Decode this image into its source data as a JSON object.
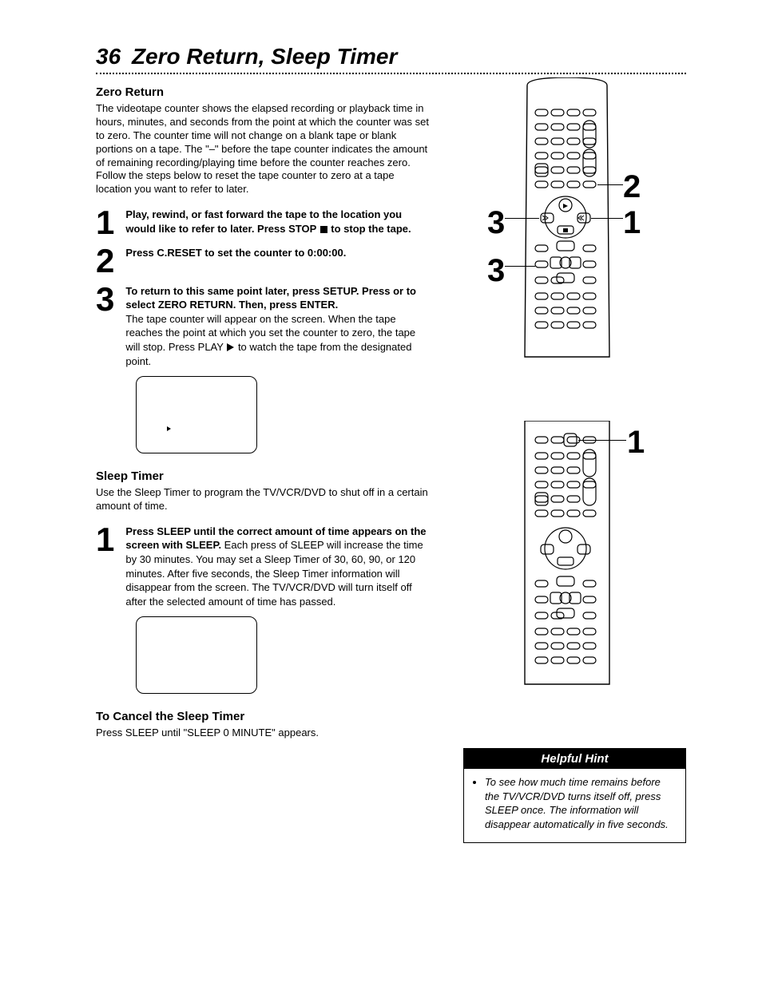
{
  "page": {
    "number": "36",
    "title": "Zero Return, Sleep Timer"
  },
  "zeroReturn": {
    "heading": "Zero Return",
    "intro": "The videotape counter shows the elapsed recording or playback time in hours, minutes, and seconds from the point at which the counter was set to zero. The counter time will not change on a blank tape or blank portions on a tape. The \"–\" before the tape counter indicates the amount of remaining recording/playing time before the counter reaches zero. Follow the steps below to reset the tape counter to zero at a tape location you want to refer to later.",
    "step1": {
      "num": "1",
      "boldA": "Play, rewind, or fast forward the tape to the location you would like to refer to later. Press STOP ",
      "boldB": " to stop the tape."
    },
    "step2": {
      "num": "2",
      "bold": "Press C.RESET to set the counter to 0:00:00."
    },
    "step3": {
      "num": "3",
      "bold": "To return to this same point later, press SETUP. Press      or      to select ZERO RETURN. Then, press ENTER.",
      "after": "The tape counter will appear on the screen. When the tape reaches the point at which you set the counter to zero, the tape will stop. Press PLAY ",
      "afterB": " to watch the tape from the designated point."
    }
  },
  "sleepTimer": {
    "heading": "Sleep Timer",
    "intro": "Use the Sleep Timer to program the TV/VCR/DVD to shut off in a certain amount of time.",
    "step1": {
      "num": "1",
      "bold": "Press SLEEP until the correct amount of time appears on the screen with SLEEP. ",
      "regular": "Each press of SLEEP will increase the time by 30 minutes. You may set a Sleep Timer of 30, 60, 90, or 120 minutes. After five seconds, the Sleep Timer information will disappear from the screen. The TV/VCR/DVD will turn itself off after the selected amount of time has passed."
    },
    "cancelHeading": "To Cancel the Sleep Timer",
    "cancelBody": "Press SLEEP until \"SLEEP 0 MINUTE\" appears."
  },
  "callouts": {
    "r1_c2": "2",
    "r1_c1": "1",
    "r1_c3a": "3",
    "r1_c3b": "3",
    "r2_c1": "1"
  },
  "hint": {
    "title": "Helpful Hint",
    "body": "To see how much time remains before the TV/VCR/DVD turns itself off, press SLEEP once. The information will disappear automatically in five seconds."
  }
}
